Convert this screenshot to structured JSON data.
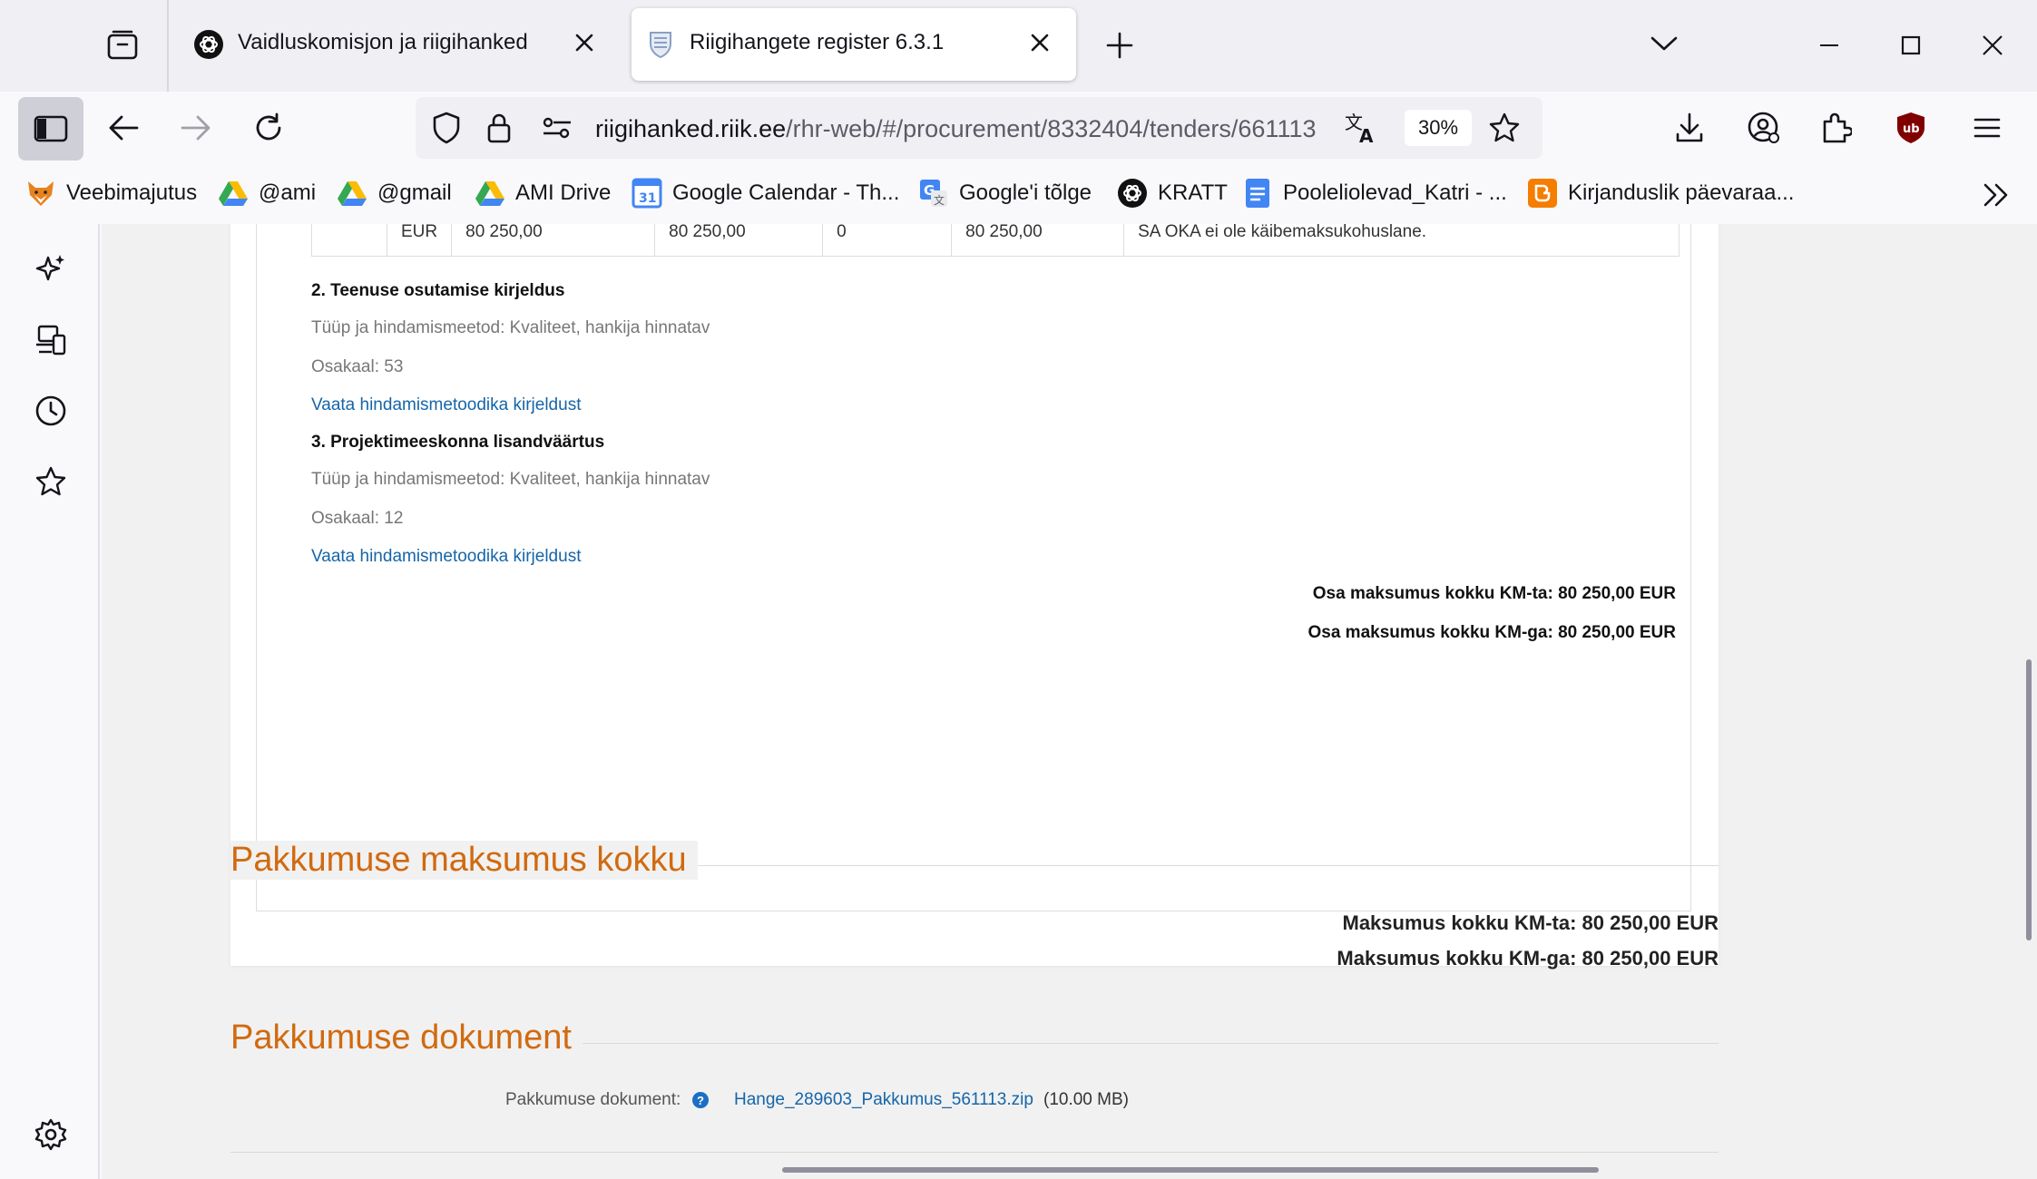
{
  "tabs": [
    {
      "title": "Vaidluskomisjon ja riigihanked",
      "favicon": "openai-icon",
      "active": false
    },
    {
      "title": "Riigihangete register 6.3.1",
      "favicon": "coat-of-arms-icon",
      "active": true
    }
  ],
  "navbar": {
    "url_host": "riigihanked.riik.ee",
    "url_path": "/rhr-web/#/procurement/8332404/tenders/661113",
    "zoom": "30%"
  },
  "bookmarks": [
    {
      "label": "Veebimajutus",
      "icon": "fox-icon"
    },
    {
      "label": "@ami",
      "icon": "drive-icon"
    },
    {
      "label": "@gmail",
      "icon": "drive-icon"
    },
    {
      "label": "AMI Drive",
      "icon": "drive-icon"
    },
    {
      "label": "Google Calendar - Th...",
      "icon": "calendar-icon"
    },
    {
      "label": "Google'i tõlge",
      "icon": "translate-icon"
    },
    {
      "label": "KRATT",
      "icon": "openai-icon"
    },
    {
      "label": "Pooleliolevad_Katri - ...",
      "icon": "docs-icon"
    },
    {
      "label": "Kirjanduslik päevaraa...",
      "icon": "blogger-icon"
    }
  ],
  "cost_row": {
    "currency": "EUR",
    "price_without_vat": "80 250,00",
    "price_with_vat": "80 250,00",
    "vat": "0",
    "total": "80 250,00",
    "note": "SA OKA ei ole käibemaksukohuslane."
  },
  "criteria": [
    {
      "title": "2. Teenuse osutamise kirjeldus",
      "type": "Tüüp ja hindamismeetod: Kvaliteet, hankija hinnatav",
      "weight": "Osakaal: 53",
      "link": "Vaata hindamismetoodika kirjeldust"
    },
    {
      "title": "3. Projektimeeskonna lisandväärtus",
      "type": "Tüüp ja hindamismeetod: Kvaliteet, hankija hinnatav",
      "weight": "Osakaal: 12",
      "link": "Vaata hindamismetoodika kirjeldust"
    }
  ],
  "part_totals": {
    "without_vat": "Osa maksumus kokku KM-ta: 80 250,00 EUR",
    "with_vat": "Osa maksumus kokku KM-ga: 80 250,00 EUR"
  },
  "offer_total": {
    "heading": "Pakkumuse maksumus kokku",
    "without_vat": "Maksumus kokku KM-ta: 80 250,00 EUR",
    "with_vat": "Maksumus kokku KM-ga: 80 250,00 EUR"
  },
  "offer_document": {
    "heading": "Pakkumuse dokument",
    "label": "Pakkumuse dokument:",
    "help": "?",
    "file_name": "Hange_289603_Pakkumus_561113.zip",
    "file_size": "(10.00 MB)"
  },
  "colors": {
    "accent_heading": "#d16a10",
    "link": "#1565a8"
  }
}
